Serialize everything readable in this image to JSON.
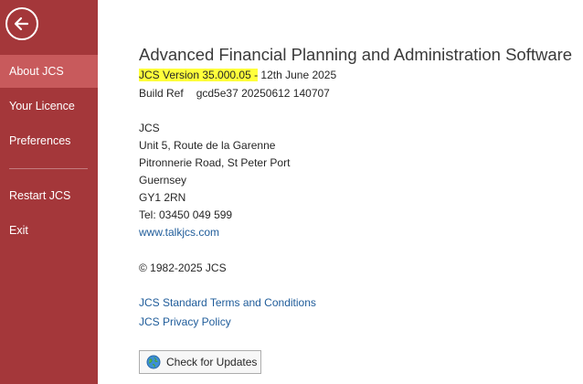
{
  "sidebar": {
    "items": [
      {
        "label": "About JCS"
      },
      {
        "label": "Your Licence"
      },
      {
        "label": "Preferences"
      },
      {
        "label": "Restart JCS"
      },
      {
        "label": "Exit"
      }
    ],
    "active_item": "About JCS"
  },
  "about": {
    "title": "Advanced Financial Planning and Administration Software",
    "version_highlighted": "JCS Version 35.000.05 -",
    "version_date": " 12th June 2025",
    "build_label": "Build Ref",
    "build_value": "gcd5e37 20250612 140707",
    "address": {
      "company": "JCS",
      "line1": "Unit 5, Route de la Garenne",
      "line2": "Pitronnerie Road, St Peter Port",
      "line3": "Guernsey",
      "postcode": "GY1 2RN",
      "tel": "Tel: 03450 049 599",
      "website": "www.talkjcs.com"
    },
    "copyright": "© 1982-2025 JCS",
    "terms_link": "JCS Standard Terms and Conditions",
    "privacy_link": "JCS Privacy Policy",
    "update_button": "Check for Updates"
  },
  "colors": {
    "sidebar": "#a4373a",
    "sidebar_active": "#c85a5c",
    "link": "#1f5c9a",
    "highlight": "#ffff3b"
  },
  "icons": {
    "back": "back-arrow-icon",
    "update": "globe-icon"
  }
}
